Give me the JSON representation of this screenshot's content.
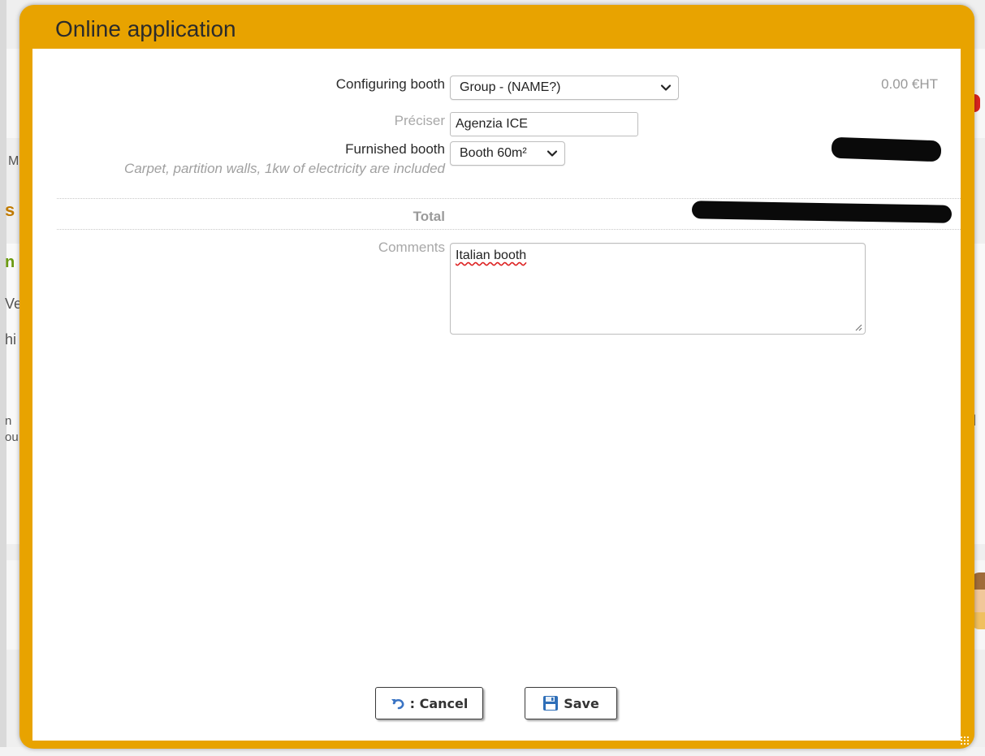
{
  "dialog": {
    "title": "Online application"
  },
  "form": {
    "configuring_booth": {
      "label": "Configuring booth",
      "selected": "Group - (NAME?)",
      "price": "0.00 €HT"
    },
    "preciser": {
      "label": "Préciser",
      "value": "Agenzia ICE"
    },
    "furnished_booth": {
      "label": "Furnished booth",
      "note": "Carpet, partition walls, 1kw of electricity are included",
      "selected": "Booth 60m²"
    },
    "total": {
      "label": "Total"
    },
    "comments": {
      "label": "Comments",
      "value": "Italian booth"
    }
  },
  "buttons": {
    "cancel_label": ": Cancel",
    "save_label": "Save"
  },
  "background": {
    "fragments": [
      "M",
      "s",
      "n",
      "Ve",
      "hi",
      "n",
      "ou",
      "l"
    ]
  },
  "colors": {
    "dialog_frame": "#e8a300",
    "body": "#ffffff"
  }
}
